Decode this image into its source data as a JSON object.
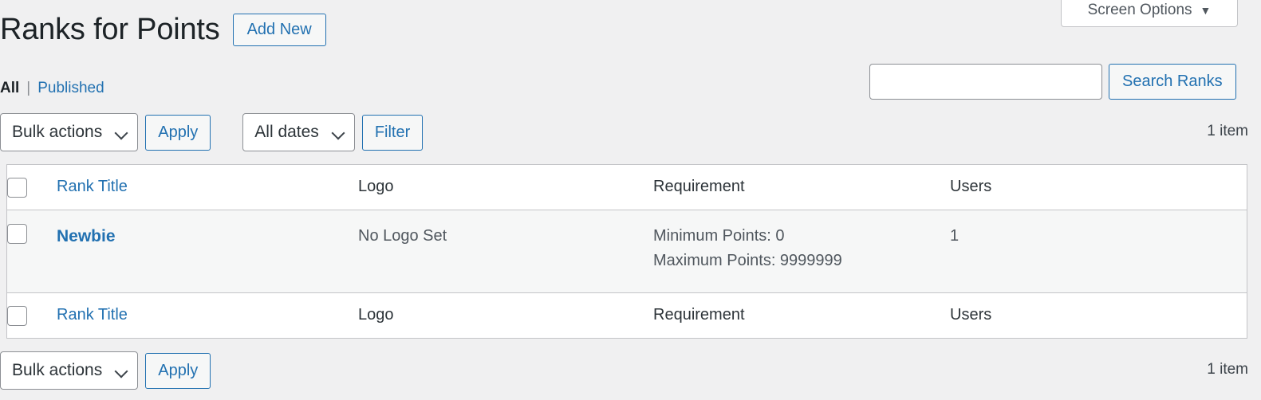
{
  "screen_meta": {
    "screen_options_label": "Screen Options",
    "chevron": "▼"
  },
  "header": {
    "page_title": "Ranks for Points",
    "add_new_label": "Add New"
  },
  "views": {
    "all_label": "All",
    "separator": "|",
    "published_label": "Published"
  },
  "search": {
    "value": "",
    "placeholder": "",
    "submit_label": "Search Ranks"
  },
  "tablenav_top": {
    "bulk_actions_label": "Bulk actions",
    "apply_label": "Apply",
    "date_filter_label": "All dates",
    "filter_label": "Filter",
    "displaying_num": "1 item"
  },
  "tablenav_bottom": {
    "bulk_actions_label": "Bulk actions",
    "apply_label": "Apply",
    "displaying_num": "1 item"
  },
  "table": {
    "columns": {
      "title": "Rank Title",
      "logo": "Logo",
      "requirement": "Requirement",
      "users": "Users"
    },
    "rows": [
      {
        "title": "Newbie",
        "logo": "No Logo Set",
        "requirement_min": "Minimum Points: 0",
        "requirement_max": "Maximum Points: 9999999",
        "users": "1"
      }
    ]
  },
  "colors": {
    "link": "#2271b1",
    "page_bg": "#f0f0f1",
    "row_alt_bg": "#f6f7f7",
    "border": "#c3c4c7",
    "text": "#3c434a"
  }
}
